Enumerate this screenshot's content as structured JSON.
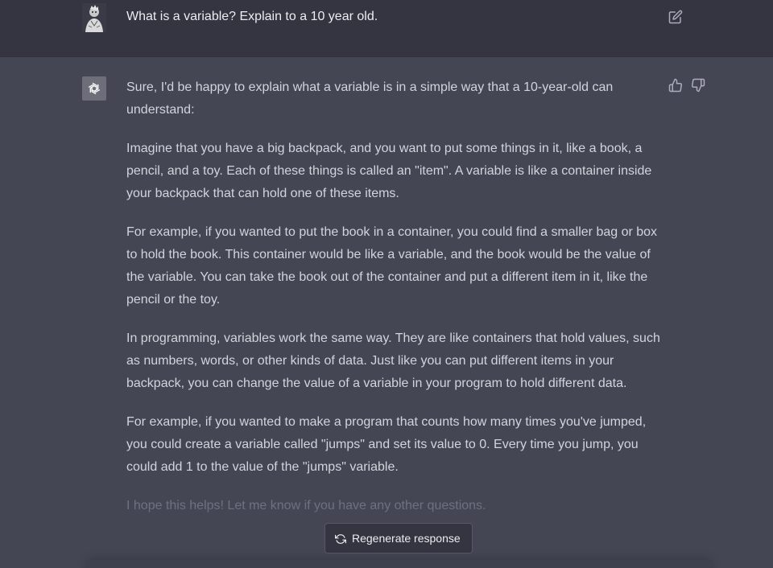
{
  "user_message": {
    "text": "What is a variable? Explain to a 10 year old."
  },
  "assistant_message": {
    "paragraphs": [
      "Sure, I'd be happy to explain what a variable is in a simple way that a 10-year-old can understand:",
      "Imagine that you have a big backpack, and you want to put some things in it, like a book, a pencil, and a toy. Each of these things is called an \"item\". A variable is like a container inside your backpack that can hold one of these items.",
      "For example, if you wanted to put the book in a container, you could find a smaller bag or box to hold the book. This container would be like a variable, and the book would be the value of the variable. You can take the book out of the container and put a different item in it, like the pencil or the toy.",
      "In programming, variables work the same way. They are like containers that hold values, such as numbers, words, or other kinds of data. Just like you can put different items in your backpack, you can change the value of a variable in your program to hold different data.",
      "For example, if you wanted to make a program that counts how many times you've jumped, you could create a variable called \"jumps\" and set its value to 0. Every time you jump, you could add 1 to the value of the \"jumps\" variable.",
      "I hope this helps! Let me know if you have any other questions."
    ]
  },
  "actions": {
    "regenerate_label": "Regenerate response"
  },
  "icons": {
    "edit": "edit-icon",
    "thumbs_up": "thumbs-up-icon",
    "thumbs_down": "thumbs-down-icon",
    "regenerate": "refresh-icon",
    "bot": "openai-logo-icon"
  },
  "colors": {
    "user_bg": "#343541",
    "assistant_bg": "#444654",
    "text": "#d1d5db",
    "bot_avatar_bg": "#6d6e7a"
  }
}
